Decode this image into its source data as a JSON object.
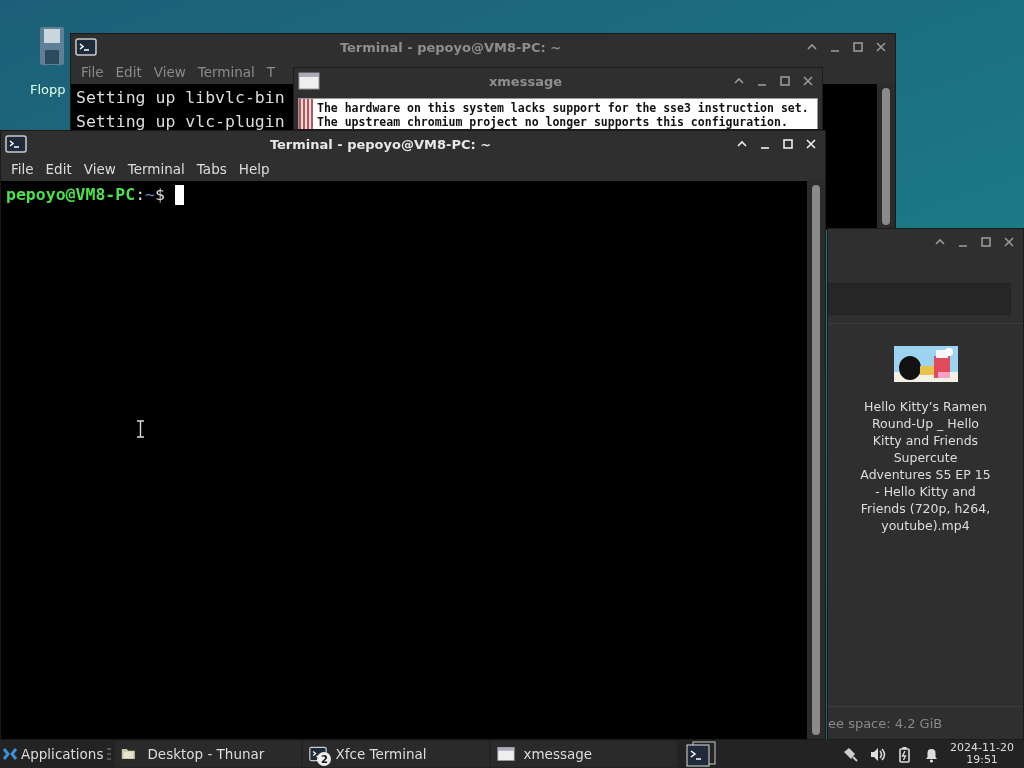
{
  "desktop": {
    "icons": [
      {
        "label": "Flopp"
      }
    ]
  },
  "windows": [
    {
      "kind": "terminal",
      "title": "Terminal - pepoyo@VM8-PC: ~",
      "active": false,
      "menu": [
        "File",
        "Edit",
        "View",
        "Terminal",
        "T"
      ],
      "lines": [
        "Setting up libvlc-bin",
        "Setting up vlc-plugin"
      ]
    },
    {
      "kind": "xmessage",
      "title": "xmessage",
      "active": false,
      "lines": [
        "The hardware on this system lacks support for the sse3 instruction set.",
        "The upstream chromium project no longer supports this configuration."
      ]
    },
    {
      "kind": "filemanager",
      "files": [
        {
          "name": "Hello Kitty’s Ramen Round-Up _ Hello Kitty and Friends Supercute Adventures S5 EP 15 - Hello Kitty and Friends (720p, h264, youtube).mp4"
        }
      ],
      "status": "ee space: 4.2 GiB"
    },
    {
      "kind": "terminal",
      "title": "Terminal - pepoyo@VM8-PC: ~",
      "active": true,
      "menu": [
        "File",
        "Edit",
        "View",
        "Terminal",
        "Tabs",
        "Help"
      ],
      "prompt": {
        "user": "pepoyo@VM8-PC",
        "separator": ":",
        "path": "~",
        "symbol": "$"
      }
    }
  ],
  "taskbar": {
    "menu_label": "Applications",
    "tasks": [
      {
        "label": "Desktop - Thunar",
        "kind": "folder"
      },
      {
        "label": "Xfce Terminal",
        "kind": "terminal",
        "count": "2"
      },
      {
        "label": "xmessage",
        "kind": "window"
      }
    ],
    "clock": {
      "date": "2024-11-20",
      "time": "19:51"
    }
  }
}
